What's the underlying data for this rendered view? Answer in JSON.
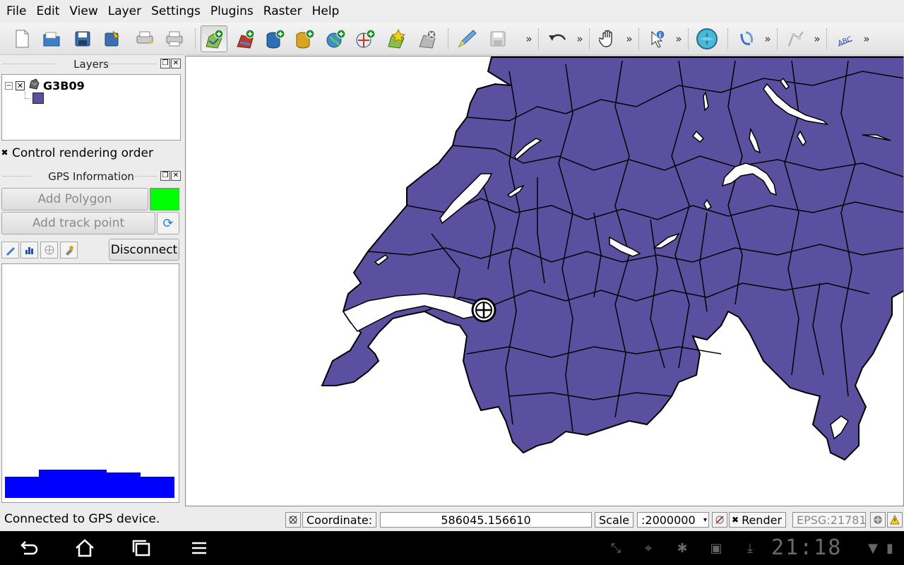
{
  "menu": [
    "File",
    "Edit",
    "View",
    "Layer",
    "Settings",
    "Plugins",
    "Raster",
    "Help"
  ],
  "toolbar": {
    "more_glyph": "»"
  },
  "layers_panel": {
    "title": "Layers",
    "layer_name": "G3B09",
    "layer_color": "#5b4fa0"
  },
  "control_rendering_order": "Control rendering order",
  "gps_panel": {
    "title": "GPS Information",
    "add_polygon": "Add Polygon",
    "add_track_point": "Add track point",
    "disconnect": "Disconnect",
    "polygon_color": "#00ff00",
    "graph_color": "#0000ff"
  },
  "status": {
    "message": "Connected to GPS device.",
    "coordinate_label": "Coordinate:",
    "coordinate_value": "586045.156610",
    "scale_label": "Scale",
    "scale_value": ":2000000",
    "render_label": "Render",
    "crs": "EPSG:21781"
  },
  "system": {
    "clock": "21:18"
  },
  "map": {
    "fill_color": "#5b4fa0"
  }
}
